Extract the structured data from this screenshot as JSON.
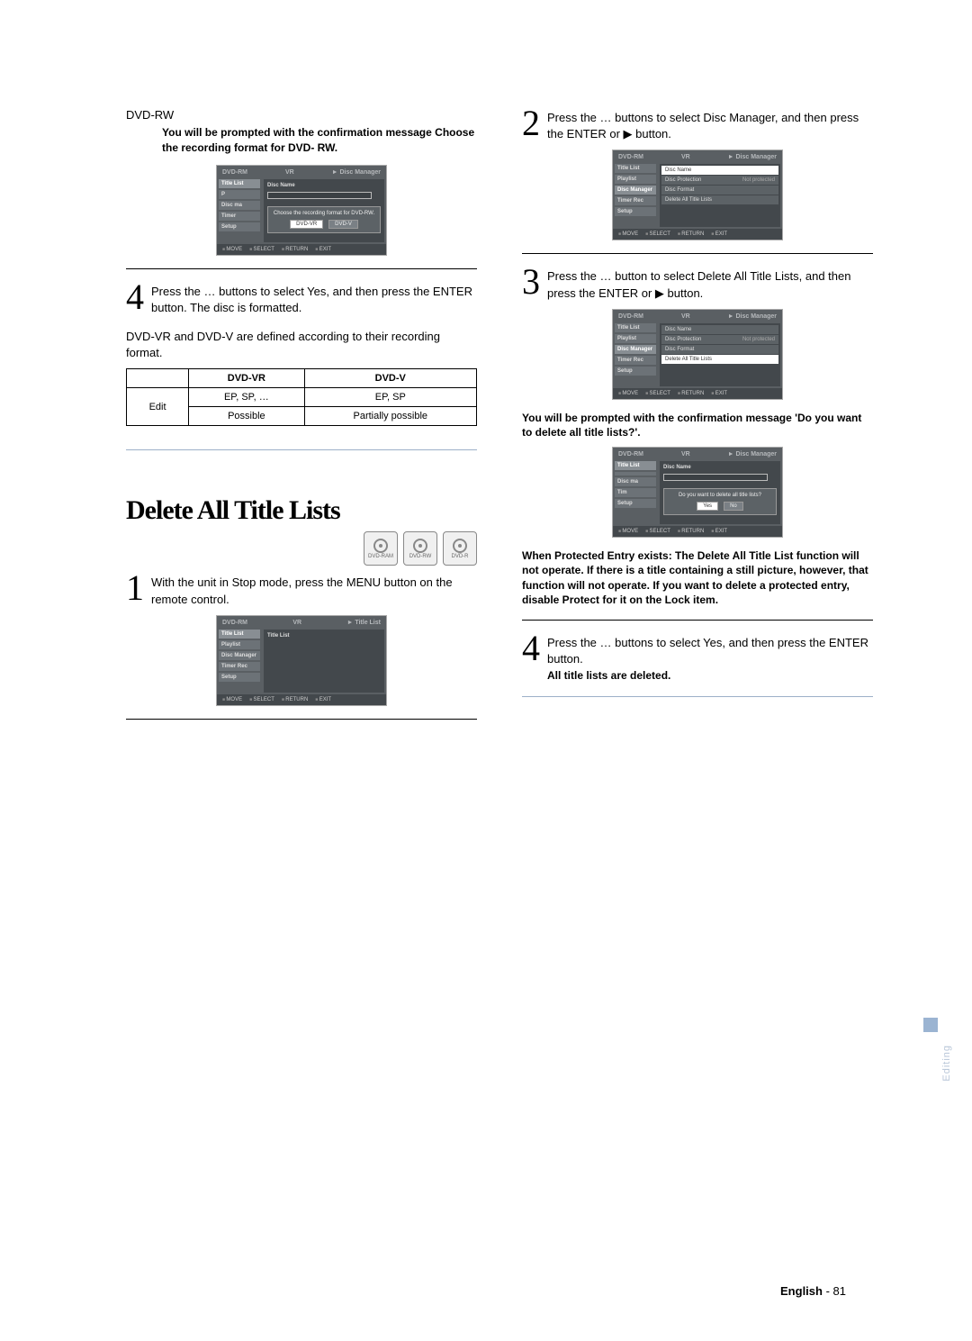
{
  "left": {
    "dvd_rw_label": "DVD-RW",
    "prompt_note": "You will be prompted with the confirmation message Choose the recording format for DVD- RW.",
    "ui1": {
      "hdr_left": "DVD-RM",
      "hdr_mid": "VR",
      "hdr_right": "► Disc Manager",
      "sidebar": [
        "Title List",
        "P",
        "Disc ma",
        "Timer",
        "Setup"
      ],
      "content_label": "Disc Name",
      "dialog_msg": "Choose the recording format for DVD-RW.",
      "btn1": "DVD-VR",
      "btn2": "DVD-V",
      "footer": [
        "MOVE",
        "SELECT",
        "RETURN",
        "EXIT"
      ]
    },
    "step4_text": "Press the … buttons to select Yes, and then press the ENTER button.\nThe disc is formatted.",
    "body_line": "DVD-VR and DVD-V are defined according to their recording format.",
    "table": {
      "h1": "DVD-VR",
      "h2": "DVD-V",
      "r1c0": "",
      "r1c1": "EP, SP, …",
      "r1c2": "EP, SP",
      "r2c0": "Edit",
      "r2c1": "Possible",
      "r2c2": "Partially possible"
    },
    "section_title": "Delete All Title Lists",
    "disc_labels": [
      "DVD-RAM",
      "DVD-RW",
      "DVD-R"
    ],
    "step1_text": "With the unit in Stop mode, press the MENU button on the remote control.",
    "ui2": {
      "hdr_left": "DVD-RM",
      "hdr_mid": "VR",
      "hdr_right": "► Title List",
      "sidebar": [
        "Title List",
        "Playlist",
        "Disc Manager",
        "Timer Rec",
        "Setup"
      ],
      "content_label": "Title List",
      "footer": [
        "MOVE",
        "SELECT",
        "RETURN",
        "EXIT"
      ]
    }
  },
  "right": {
    "step2_text": "Press the … buttons to select Disc Manager, and then press the ENTER or ▶ button.",
    "ui3": {
      "hdr_left": "DVD-RM",
      "hdr_mid": "VR",
      "hdr_right": "► Disc Manager",
      "sidebar": [
        "Title List",
        "Playlist",
        "Disc Manager",
        "Timer Rec",
        "Setup"
      ],
      "items": [
        {
          "l": "Disc Name",
          "r": ""
        },
        {
          "l": "Disc Protection",
          "r": "Not protected"
        },
        {
          "l": "Disc Format",
          "r": ""
        },
        {
          "l": "Delete All Title Lists",
          "r": ""
        }
      ],
      "footer": [
        "MOVE",
        "SELECT",
        "RETURN",
        "EXIT"
      ]
    },
    "step3_text": "Press the … button to select Delete All Title Lists, and then press the ENTER or ▶ button.",
    "ui4": {
      "hdr_left": "DVD-RM",
      "hdr_mid": "VR",
      "hdr_right": "► Disc Manager",
      "sidebar": [
        "Title List",
        "Playlist",
        "Disc Manager",
        "Timer Rec",
        "Setup"
      ],
      "items": [
        {
          "l": "Disc Name",
          "r": ""
        },
        {
          "l": "Disc Protection",
          "r": "Not protected"
        },
        {
          "l": "Disc Format",
          "r": ""
        },
        {
          "l": "Delete All Title Lists",
          "r": ""
        }
      ],
      "sel_index": 3,
      "footer": [
        "MOVE",
        "SELECT",
        "RETURN",
        "EXIT"
      ]
    },
    "confirm_note": "You will be prompted with the confirmation message 'Do you want to delete all title lists?'.",
    "ui5": {
      "hdr_left": "DVD-RM",
      "hdr_mid": "VR",
      "hdr_right": "► Disc Manager",
      "sidebar": [
        "Title List",
        "",
        "Disc ma",
        "Tim",
        "Setup"
      ],
      "content_label": "Disc Name",
      "dialog_msg": "Do you want to delete all title lists?",
      "btn1": "Yes",
      "btn2": "No",
      "footer": [
        "MOVE",
        "SELECT",
        "RETURN",
        "EXIT"
      ]
    },
    "protect_note": "When Protected Entry exists: The Delete All Title List function will not operate. If there is a title containing a still picture, however, that function will not operate. If you want to delete a protected entry, disable Protect for it on the Lock item.",
    "step4_text": "Press the … buttons to select Yes, and then press the ENTER button.",
    "deleted_note": "All title lists are deleted."
  },
  "side_label": "Editing",
  "footer": {
    "lang": "English",
    "page": "- 81"
  }
}
